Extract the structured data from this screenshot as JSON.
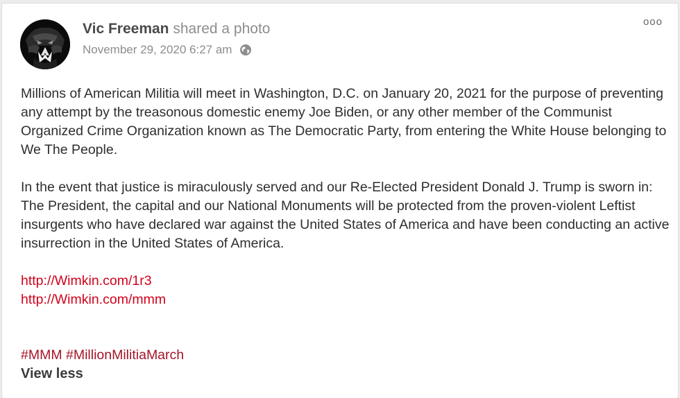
{
  "post": {
    "author_name": "Vic Freeman",
    "action_text": "shared a photo",
    "timestamp": "November 29, 2020 6:27 am",
    "privacy_icon": "globe-icon",
    "more_label": "ooo",
    "paragraphs": [
      "Millions of American Militia will meet in Washington, D.C. on January 20, 2021 for the purpose of preventing any attempt by the treasonous domestic enemy Joe Biden, or any other member of the Communist Organized Crime Organization known as The Democratic Party, from entering the White House belonging to We The People.",
      "In the event that justice is miraculously served and our Re-Elected President Donald J. Trump is sworn in: The President, the capital and our National Monuments will be protected from the proven-violent Leftist insurgents who have declared war against the United States of America and have been conducting an active insurrection in the United States of America."
    ],
    "links": [
      "http://Wimkin.com/1r3",
      "http://Wimkin.com/mmm"
    ],
    "hashtags": [
      "#MMM",
      "#MillionMilitiaMarch"
    ],
    "view_less_label": "View less"
  },
  "colors": {
    "link": "#d0021b",
    "hashtag": "#a31428",
    "author": "#4a4a4a",
    "muted": "#8d8d8d"
  }
}
